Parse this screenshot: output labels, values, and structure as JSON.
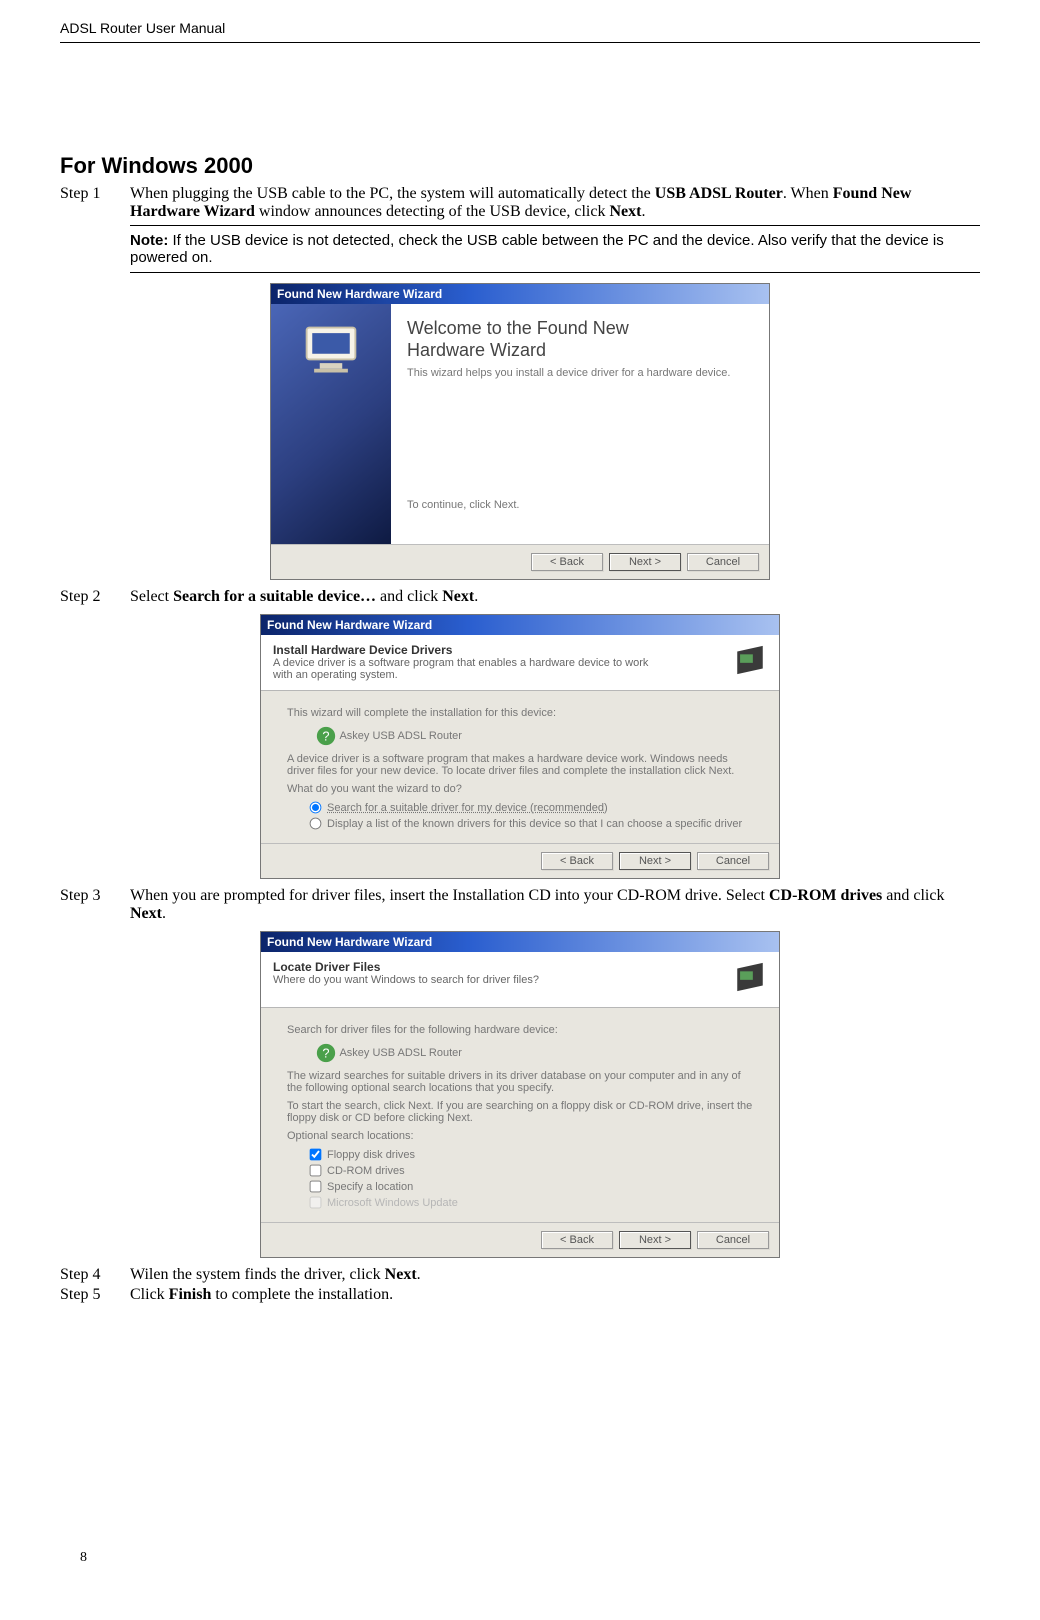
{
  "header": {
    "title": "ADSL Router User Manual"
  },
  "section_title": "For Windows 2000",
  "steps": {
    "s1": {
      "label": "Step 1",
      "t1": "When plugging the USB cable to the PC, the system will automatically detect the ",
      "b1": "USB ADSL Router",
      "t2": ". When ",
      "b2": "Found New Hardware Wizard",
      "t3": " window announces detecting of the USB device, click ",
      "b3": "Next",
      "t4": "."
    },
    "s2": {
      "label": "Step 2",
      "t1": "Select ",
      "b1": "Search for a suitable device…",
      "t2": " and click ",
      "b2": "Next",
      "t3": "."
    },
    "s3": {
      "label": "Step 3",
      "t1": "When you are prompted for driver files, insert the Installation CD into your CD-ROM drive. Select ",
      "b1": "CD-ROM drives",
      "t2": " and click ",
      "b2": "Next",
      "t3": "."
    },
    "s4": {
      "label": "Step 4",
      "t1": "Wilen the system finds the driver, click ",
      "b1": "Next",
      "t2": "."
    },
    "s5": {
      "label": "Step 5",
      "t1": "Click ",
      "b1": "Finish",
      "t2": " to complete the installation."
    }
  },
  "note": {
    "label": "Note:",
    "text": " If the USB device is not detected, check the USB cable between the PC and the device. Also verify that the device is powered on."
  },
  "wizard_bar": "Found New Hardware Wizard",
  "wiz1": {
    "title1": "Welcome to the Found New",
    "title2": "Hardware Wizard",
    "desc": "This wizard helps you install a device driver for a hardware device.",
    "cont": "To continue, click Next."
  },
  "wiz2": {
    "h_title": "Install Hardware Device Drivers",
    "h_sub": "A device driver is a software program that enables a hardware device to work with an operating system.",
    "line1": "This wizard will complete the installation for this device:",
    "device": "Askey USB ADSL Router",
    "line2": "A device driver is a software program that makes a hardware device work. Windows needs driver files for your new device. To locate driver files and complete the installation click Next.",
    "line3": "What do you want the wizard to do?",
    "opt1": "Search for a suitable driver for my device (recommended)",
    "opt2": "Display a list of the known drivers for this device so that I can choose a specific driver"
  },
  "wiz3": {
    "h_title": "Locate Driver Files",
    "h_sub": "Where do you want Windows to search for driver files?",
    "line1": "Search for driver files for the following hardware device:",
    "device": "Askey USB ADSL Router",
    "line2": "The wizard searches for suitable drivers in its driver database on your computer and in any of the following optional search locations that you specify.",
    "line3": "To start the search, click Next. If you are searching on a floppy disk or CD-ROM drive, insert the floppy disk or CD before clicking Next.",
    "opt_label": "Optional search locations:",
    "chk1": "Floppy disk drives",
    "chk2": "CD-ROM drives",
    "chk3": "Specify a location",
    "chk4": "Microsoft Windows Update"
  },
  "buttons": {
    "back": "< Back",
    "next": "Next >",
    "cancel": "Cancel"
  },
  "page_number": "8"
}
